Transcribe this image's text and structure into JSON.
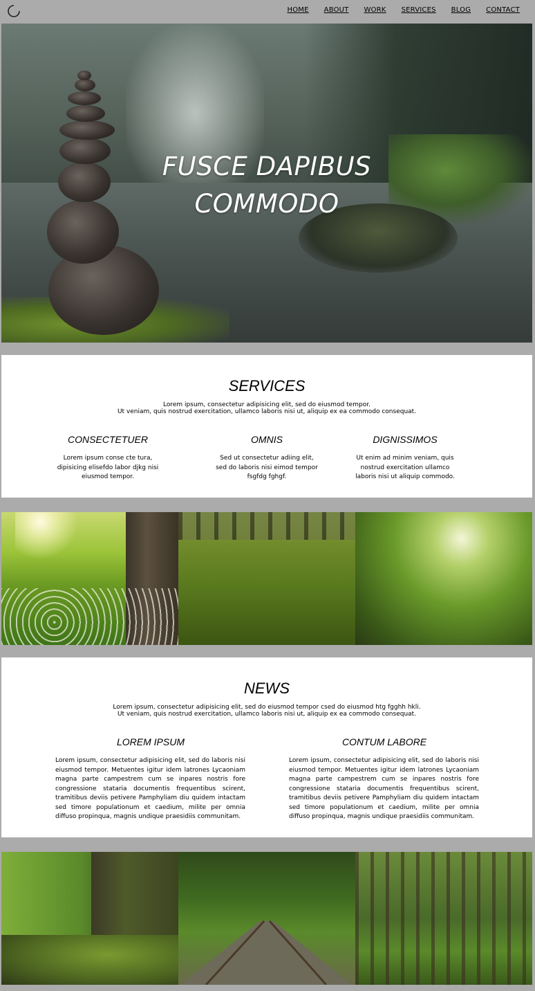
{
  "nav": {
    "items": [
      "HOME",
      "ABOUT",
      "WORK",
      "SERVICES",
      "BLOG",
      "CONTACT"
    ]
  },
  "hero": {
    "title_line1": "FUSCE DAPIBUS",
    "title_line2": "COMMODO"
  },
  "services": {
    "title": "SERVICES",
    "intro_line1": "Lorem ipsum, consectetur adipisicing elit, sed do eiusmod tempor.",
    "intro_line2": "Ut veniam, quis nostrud exercitation, ullamco laboris nisi ut, aliquip ex ea commodo consequat.",
    "columns": [
      {
        "title": "CONSECTETUER",
        "line1": "Lorem ipsum conse cte tura,",
        "line2": "dipisicing elisefdo labor djkg nisi",
        "line3": "eiusmod tempor."
      },
      {
        "title": "OMNIS",
        "line1": "Sed ut consectetur adiing elit,",
        "line2": "sed do laboris nisi eimod tempor",
        "line3": "fsgfdg fghgf."
      },
      {
        "title": "DIGNISSIMOS",
        "line1": "Ut enim ad minim veniam, quis",
        "line2": "nostrud exercitation ullamco",
        "line3": "laboris nisi ut aliquip commodo."
      }
    ]
  },
  "news": {
    "title": "NEWS",
    "intro_line1": "Lorem ipsum, consectetur adipisicing elit, sed do eiusmod tempor csed do eiusmod htg fgghh hkli.",
    "intro_line2": "Ut veniam, quis nostrud exercitation, ullamco laboris nisi ut, aliquip ex ea commodo consequat.",
    "columns": [
      {
        "title": "LOREM IPSUM",
        "text": "Lorem ipsum, consectetur adipisicing elit, sed do laboris nisi eiusmod tempor. Metuentes igitur idem latrones Lycaoniam magna parte campestrem cum se inpares nostris fore congressione stataria documentis frequentibus scirent, tramitibus deviis petivere Pamphyliam diu quidem intactam sed timore populationum et caedium, milite per omnia diffuso propinqua, magnis undique praesidiis communitam."
      },
      {
        "title": "CONTUM LABORE",
        "text": "Lorem ipsum, consectetur adipisicing elit, sed do laboris nisi eiusmod tempor. Metuentes igitur idem latrones Lycaoniam magna parte campestrem cum se inpares nostris fore congressione stataria documentis frequentibus scirent, tramitibus deviis petivere Pamphyliam diu quidem intactam sed timore populationum et caedium, milite per omnia diffuso propinqua, magnis undique praesidiis communitam."
      }
    ]
  },
  "colors": {
    "page_bg": "#ababab",
    "section_bg": "#ffffff",
    "hero_text": "#ffffff"
  }
}
